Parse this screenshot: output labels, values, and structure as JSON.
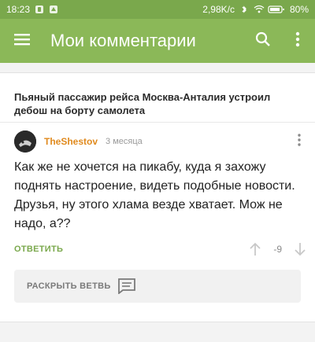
{
  "status_bar": {
    "time": "18:23",
    "speed": "2,98K/c",
    "battery": "80%"
  },
  "app_bar": {
    "title": "Мои комментарии",
    "icons": [
      "menu-icon",
      "search-icon",
      "more-vert-icon"
    ]
  },
  "post": {
    "title": "Пьяный пассажир рейса Москва-Анталия устроил дебош на борту самолета"
  },
  "comment": {
    "author": "TheShestov",
    "time": "3 месяца",
    "text": "Как же не хочется на пикабу, куда я захожу поднять настроение, видеть подобные новости. Друзья, ну этого хлама везде хватает. Мож не надо, а??",
    "reply_label": "ОТВЕТИТЬ",
    "rating": "-9"
  },
  "expand_branch": {
    "label": "РАСКРЫТЬ ВЕТВЬ"
  },
  "colors": {
    "status_bar": "#7aa84c",
    "app_bar": "#8bb858",
    "author": "#e08a1e",
    "reply": "#7aa84c"
  }
}
